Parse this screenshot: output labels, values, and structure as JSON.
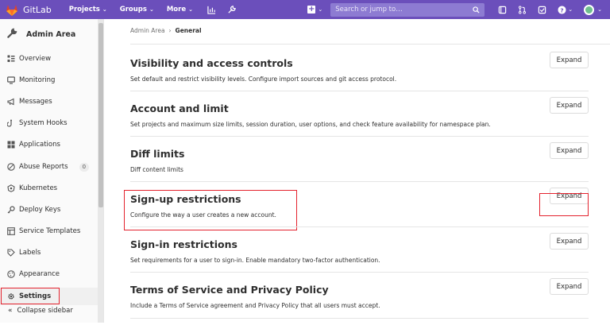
{
  "navbar": {
    "app_name": "GitLab",
    "projects": "Projects",
    "groups": "Groups",
    "more": "More",
    "search_placeholder": "Search or jump to…",
    "brand_color": "#6b4fbb"
  },
  "sidebar": {
    "title": "Admin Area",
    "items": [
      {
        "label": "Overview",
        "icon": "overview-icon"
      },
      {
        "label": "Monitoring",
        "icon": "monitor-icon"
      },
      {
        "label": "Messages",
        "icon": "megaphone-icon"
      },
      {
        "label": "System Hooks",
        "icon": "hook-icon"
      },
      {
        "label": "Applications",
        "icon": "applications-icon"
      },
      {
        "label": "Abuse Reports",
        "icon": "abuse-icon",
        "badge": "0"
      },
      {
        "label": "Kubernetes",
        "icon": "kubernetes-icon"
      },
      {
        "label": "Deploy Keys",
        "icon": "key-icon"
      },
      {
        "label": "Service Templates",
        "icon": "template-icon"
      },
      {
        "label": "Labels",
        "icon": "label-icon"
      },
      {
        "label": "Appearance",
        "icon": "appearance-icon"
      },
      {
        "label": "Settings",
        "icon": "settings-icon",
        "active": true
      }
    ],
    "collapse_label": "Collapse sidebar"
  },
  "breadcrumb": {
    "parent": "Admin Area",
    "separator": "›",
    "current": "General"
  },
  "sections": [
    {
      "title": "Visibility and access controls",
      "description": "Set default and restrict visibility levels. Configure import sources and git access protocol.",
      "button": "Expand"
    },
    {
      "title": "Account and limit",
      "description": "Set projects and maximum size limits, session duration, user options, and check feature availability for namespace plan.",
      "button": "Expand"
    },
    {
      "title": "Diff limits",
      "description": "Diff content limits",
      "button": "Expand"
    },
    {
      "title": "Sign-up restrictions",
      "description": "Configure the way a user creates a new account.",
      "button": "Expand"
    },
    {
      "title": "Sign-in restrictions",
      "description": "Set requirements for a user to sign-in. Enable mandatory two-factor authentication.",
      "button": "Expand"
    },
    {
      "title": "Terms of Service and Privacy Policy",
      "description": "Include a Terms of Service agreement and Privacy Policy that all users must accept.",
      "button": "Expand"
    }
  ],
  "highlight_color": "#e4232e"
}
